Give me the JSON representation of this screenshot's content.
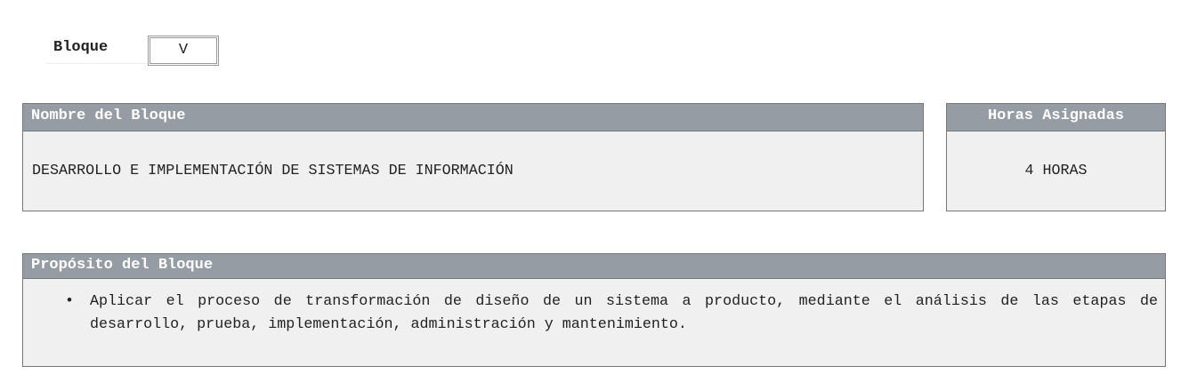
{
  "bloque": {
    "label": "Bloque",
    "value": "V"
  },
  "nombre": {
    "header": "Nombre del Bloque",
    "value": "DESARROLLO E IMPLEMENTACIÓN DE SISTEMAS DE INFORMACIÓN"
  },
  "horas": {
    "header": "Horas Asignadas",
    "value": "4 HORAS"
  },
  "proposito": {
    "header": "Propósito del Bloque",
    "items": [
      "Aplicar el proceso de transformación de diseño de un sistema a producto, mediante el análisis de las etapas de desarrollo, prueba, implementación, administración y mantenimiento."
    ]
  },
  "colors": {
    "header_bg": "#959ca3",
    "body_bg": "#f0f0f0"
  }
}
